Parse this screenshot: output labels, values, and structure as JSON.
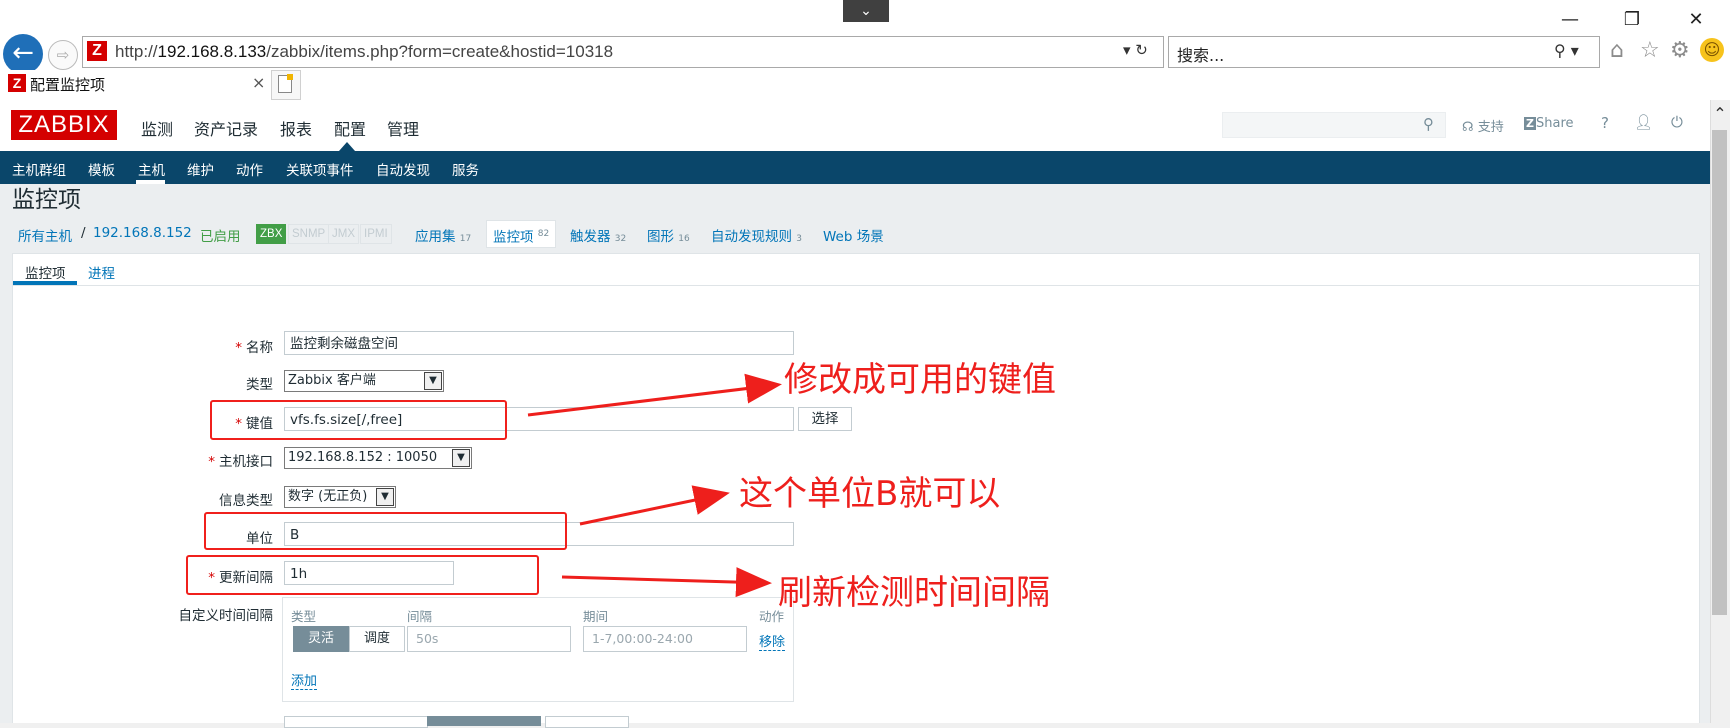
{
  "browser": {
    "url_prefix": "http://",
    "url_host": "192.168.8.133",
    "url_rest": "/zabbix/items.php?form=create&hostid=10318",
    "address_controls": "▾ ↻",
    "search_placeholder": "搜索...",
    "search_controls": "⚲ ▾",
    "tab_title": "配置监控项",
    "tab_close": "×",
    "favicon_letter": "Z",
    "window_min": "—",
    "window_restore": "❐",
    "window_close": "✕",
    "drop_tab": "⌄"
  },
  "zabbix": {
    "logo": "ZABBIX",
    "main_menu": [
      "监测",
      "资产记录",
      "报表",
      "配置",
      "管理"
    ],
    "main_menu_active": "配置",
    "header_links": {
      "support": "支持",
      "share": "Share",
      "help": "?"
    },
    "sub_menu": [
      "主机群组",
      "模板",
      "主机",
      "维护",
      "动作",
      "关联项事件",
      "自动发现",
      "服务"
    ],
    "sub_menu_active": "主机",
    "page_title": "监控项",
    "breadcrumb": {
      "all_hosts": "所有主机",
      "separator": "/",
      "host": "192.168.8.152",
      "status": "已启用",
      "interfaces": [
        "ZBX",
        "SNMP",
        "JMX",
        "IPMI"
      ],
      "apps": {
        "label": "应用集",
        "count": "17"
      },
      "items": {
        "label": "监控项",
        "count": "82"
      },
      "triggers": {
        "label": "触发器",
        "count": "32"
      },
      "graphs": {
        "label": "图形",
        "count": "16"
      },
      "discovery": {
        "label": "自动发现规则",
        "count": "3"
      },
      "web": {
        "label": "Web 场景"
      }
    },
    "form_tabs": [
      "监控项",
      "进程"
    ],
    "form": {
      "required_mark": "*",
      "name_label": "名称",
      "name_value": "监控剩余磁盘空间",
      "type_label": "类型",
      "type_value": "Zabbix 客户端",
      "key_label": "键值",
      "key_value": "vfs.fs.size[/,free]",
      "key_select_button": "选择",
      "interface_label": "主机接口",
      "interface_value": "192.168.8.152 : 10050",
      "info_type_label": "信息类型",
      "info_type_value": "数字 (无正负)",
      "units_label": "单位",
      "units_value": "B",
      "interval_label": "更新间隔",
      "interval_value": "1h",
      "custom_label": "自定义时间间隔",
      "custom": {
        "col_type": "类型",
        "col_interval": "间隔",
        "col_period": "期间",
        "col_action": "动作",
        "flexible": "灵活",
        "scheduling": "调度",
        "interval_placeholder": "50s",
        "period_placeholder": "1-7,00:00-24:00",
        "remove": "移除",
        "add": "添加"
      }
    }
  },
  "annotations": {
    "key_note": "修改成可用的键值",
    "unit_note": "这个单位B就可以",
    "interval_note": "刷新检测时间间隔",
    "color": "#ee1f1c"
  }
}
